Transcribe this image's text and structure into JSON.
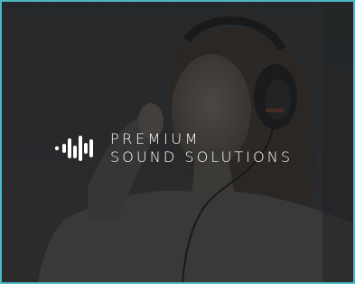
{
  "hero": {
    "image": "woman-wearing-headphones-photo"
  },
  "brand": {
    "line1": "PREMIUM",
    "line2": "SOUND SOLUTIONS",
    "logo_icon": "sound-wave-icon"
  },
  "colors": {
    "frame_border": "#4fb7c2",
    "text": "#ffffff"
  }
}
